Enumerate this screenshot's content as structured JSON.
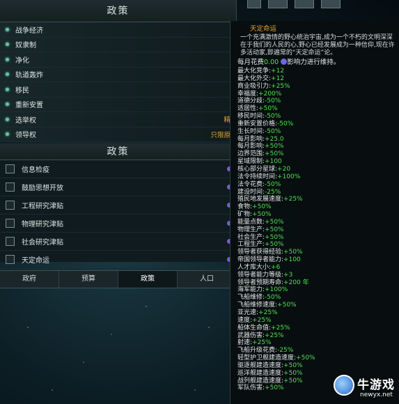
{
  "panel1": {
    "title": "政策",
    "rows": [
      {
        "label": "战争经济",
        "value": ""
      },
      {
        "label": "奴隶制",
        "value": ""
      },
      {
        "label": "净化",
        "value": ""
      },
      {
        "label": "轨道轰炸",
        "value": ""
      },
      {
        "label": "移民",
        "value": ""
      },
      {
        "label": "重新安置",
        "value": ""
      },
      {
        "label": "选举权",
        "value": "精"
      },
      {
        "label": "领导权",
        "value": "只限原"
      }
    ]
  },
  "panel2": {
    "title": "政策",
    "rows": [
      {
        "label": "信息检疫"
      },
      {
        "label": "鼓励思想开放"
      },
      {
        "label": "工程研究津贴"
      },
      {
        "label": "物理研究津贴"
      },
      {
        "label": "社会研究津贴"
      },
      {
        "label": "天定命运"
      }
    ]
  },
  "tabs": [
    "政府",
    "预算",
    "政策",
    "人口"
  ],
  "tooltip": {
    "title": "天定命运",
    "description": "一个充满激情的野心统治宇宙,成为一个不朽的文明深深在于我们的人民的心,野心已经发展成为一种信仰,现在许多活动家,即遍常的“天定命运”论。",
    "upkeep_prefix": "每月花费",
    "upkeep_value": "0.00",
    "upkeep_suffix": "影响力进行维持。",
    "modifiers": [
      {
        "label": "最大化竞争:",
        "value": "+12"
      },
      {
        "label": "最大化外交:",
        "value": "+12"
      },
      {
        "label": "商业吸引力:",
        "value": "+25%"
      },
      {
        "label": "幸福度:",
        "value": "+200%"
      },
      {
        "label": "道德分歧:",
        "value": "-50%"
      },
      {
        "label": "适居性:",
        "value": "+50%"
      },
      {
        "label": "移民时间:",
        "value": "-50%"
      },
      {
        "label": "重新安置价格:",
        "value": "-50%"
      },
      {
        "label": "生长时间:",
        "value": "-50%"
      },
      {
        "label": "每月影响:",
        "value": "+25.0"
      },
      {
        "label": "每月影响:",
        "value": "+50%"
      },
      {
        "label": "边界范围:",
        "value": "+50%"
      },
      {
        "label": "星域限制:",
        "value": "+100"
      },
      {
        "label": "核心部分星球:",
        "value": "+20"
      },
      {
        "label": "法令持续时间:",
        "value": "+100%"
      },
      {
        "label": "法令花费:",
        "value": "-50%"
      },
      {
        "label": "建设时间:",
        "value": "-25%"
      },
      {
        "label": "殖民地发展速度:",
        "value": "+25%"
      },
      {
        "label": "食物:",
        "value": "+50%"
      },
      {
        "label": "矿物:",
        "value": "+50%"
      },
      {
        "label": "能量点数:",
        "value": "+50%"
      },
      {
        "label": "物理生产:",
        "value": "+50%"
      },
      {
        "label": "社会生产:",
        "value": "+50%"
      },
      {
        "label": "工程生产:",
        "value": "+50%"
      },
      {
        "label": "领导者获得经验:",
        "value": "+50%"
      },
      {
        "label": "帝国领导者能力:",
        "value": "+100"
      },
      {
        "label": "人才库大小:",
        "value": "+6"
      },
      {
        "label": "领导者能力等级:",
        "value": "+3"
      },
      {
        "label": "领导者预期寿命:",
        "value": "+200 年"
      },
      {
        "label": "海军能力:",
        "value": "+100%"
      },
      {
        "label": "飞船维修:",
        "value": "-50%"
      },
      {
        "label": "飞船维修速度:",
        "value": "+50%"
      },
      {
        "label": "亚光速:",
        "value": "+25%"
      },
      {
        "label": "速度:",
        "value": "+25%"
      },
      {
        "label": "船体生命值:",
        "value": "+25%"
      },
      {
        "label": "武器伤害:",
        "value": "+25%"
      },
      {
        "label": "射速:",
        "value": "+25%"
      },
      {
        "label": "飞船升级花费:",
        "value": "-25%"
      },
      {
        "label": "轻型护卫舰建造速度:",
        "value": "+50%"
      },
      {
        "label": "驱逐舰建造速度:",
        "value": "+50%"
      },
      {
        "label": "巡洋舰建造速度:",
        "value": "+50%"
      },
      {
        "label": "战列舰建造速度:",
        "value": "+50%"
      },
      {
        "label": "军队伤害:",
        "value": "+50%"
      }
    ]
  },
  "watermark": {
    "name": "牛游戏",
    "url": "newyx.net"
  },
  "colors": {
    "accent_orange": "#e0a23a",
    "positive_green": "#4fe04f"
  }
}
